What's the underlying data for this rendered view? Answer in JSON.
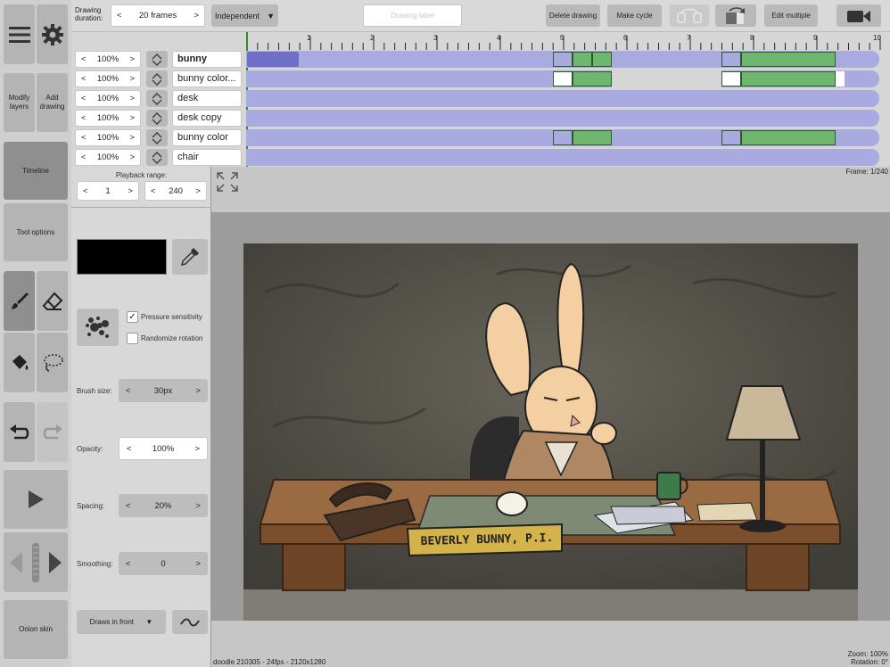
{
  "left_toolbar": {
    "modify_layers": "Modify layers",
    "add_drawing": "Add drawing",
    "timeline": "Timeline",
    "tool_options": "Tool options",
    "onion_skin": "Onion skin"
  },
  "top_bar": {
    "drawing_duration_label": "Drawing duration:",
    "drawing_duration_value": "20 frames",
    "mode_value": "Independent",
    "drawing_label_placeholder": "Drawing label",
    "delete_drawing": "Delete drawing",
    "make_cycle": "Make cycle",
    "edit_multiple": "Edit multiple"
  },
  "ruler": {
    "ticks": [
      "1",
      "2",
      "3",
      "4",
      "5",
      "6",
      "7",
      "8",
      "9",
      "10"
    ]
  },
  "layers": [
    {
      "name": "bunny",
      "opacity": "100%",
      "active": true
    },
    {
      "name": "bunny color...",
      "opacity": "100%",
      "active": false
    },
    {
      "name": "desk",
      "opacity": "100%",
      "active": false
    },
    {
      "name": "desk copy",
      "opacity": "100%",
      "active": false
    },
    {
      "name": "bunny color",
      "opacity": "100%",
      "active": false
    },
    {
      "name": "chair",
      "opacity": "100%",
      "active": false
    }
  ],
  "tool_options": {
    "playback_range_label": "Playback range:",
    "range_start": "1",
    "range_end": "240",
    "pressure_sensitivity": "Pressure sensitivity",
    "randomize_rotation": "Randomize rotation",
    "brush_size_label": "Brush size:",
    "brush_size_value": "30px",
    "opacity_label": "Opacity:",
    "opacity_value": "100%",
    "spacing_label": "Spacing:",
    "spacing_value": "20%",
    "smoothing_label": "Smoothing:",
    "smoothing_value": "0",
    "draw_mode": "Draws in front",
    "color_hex": "#000000"
  },
  "canvas": {
    "frame_readout": "Frame: 1/240",
    "file_info": "doodle 210305 - 24fps - 2120x1280",
    "zoom": "Zoom: 100%",
    "rotation": "Rotation: 0°",
    "desk_sign": "BEVERLY BUNNY, P.I."
  },
  "colors": {
    "track": "#a9aadf",
    "keyframe": "#6fb66f",
    "toolbar": "#b4b4b4"
  }
}
